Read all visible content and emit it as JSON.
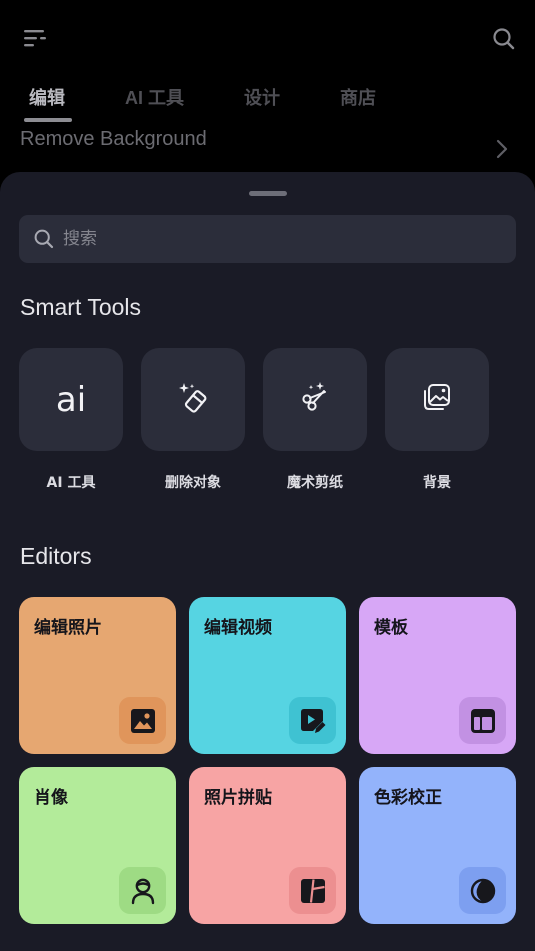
{
  "header": {
    "menu_icon": "menu-icon",
    "search_icon": "search-icon"
  },
  "tabs": [
    {
      "label": "编辑",
      "active": true
    },
    {
      "label": "AI 工具",
      "active": false
    },
    {
      "label": "设计",
      "active": false
    },
    {
      "label": "商店",
      "active": false
    }
  ],
  "behind_row": {
    "label": "Remove Background",
    "icon": "chevron-right-icon"
  },
  "sheet": {
    "search": {
      "placeholder": "搜索",
      "value": ""
    },
    "smart_tools": {
      "title": "Smart Tools",
      "items": [
        {
          "label": "AI 工具",
          "icon_text": "ai",
          "icon": "ai-icon"
        },
        {
          "label": "删除对象",
          "icon": "eraser-sparkle-icon"
        },
        {
          "label": "魔术剪纸",
          "icon": "scissors-sparkle-icon"
        },
        {
          "label": "背景",
          "icon": "background-image-icon"
        }
      ]
    },
    "editors": {
      "title": "Editors",
      "items": [
        {
          "label": "编辑照片",
          "icon": "photo-icon",
          "color": "#e6a771",
          "icon_bg": "#e0955b"
        },
        {
          "label": "编辑视频",
          "icon": "video-edit-icon",
          "color": "#56d4e2",
          "icon_bg": "#3fc2d2"
        },
        {
          "label": "模板",
          "icon": "template-icon",
          "color": "#d7a7f6",
          "icon_bg": "#c291e3"
        },
        {
          "label": "肖像",
          "icon": "portrait-icon",
          "color": "#b3eb9a",
          "icon_bg": "#9edb84"
        },
        {
          "label": "照片拼贴",
          "icon": "collage-icon",
          "color": "#f7a4a4",
          "icon_bg": "#ec8f90"
        },
        {
          "label": "色彩校正",
          "icon": "color-correction-icon",
          "color": "#93b3fb",
          "icon_bg": "#7d9ff0"
        }
      ]
    }
  }
}
